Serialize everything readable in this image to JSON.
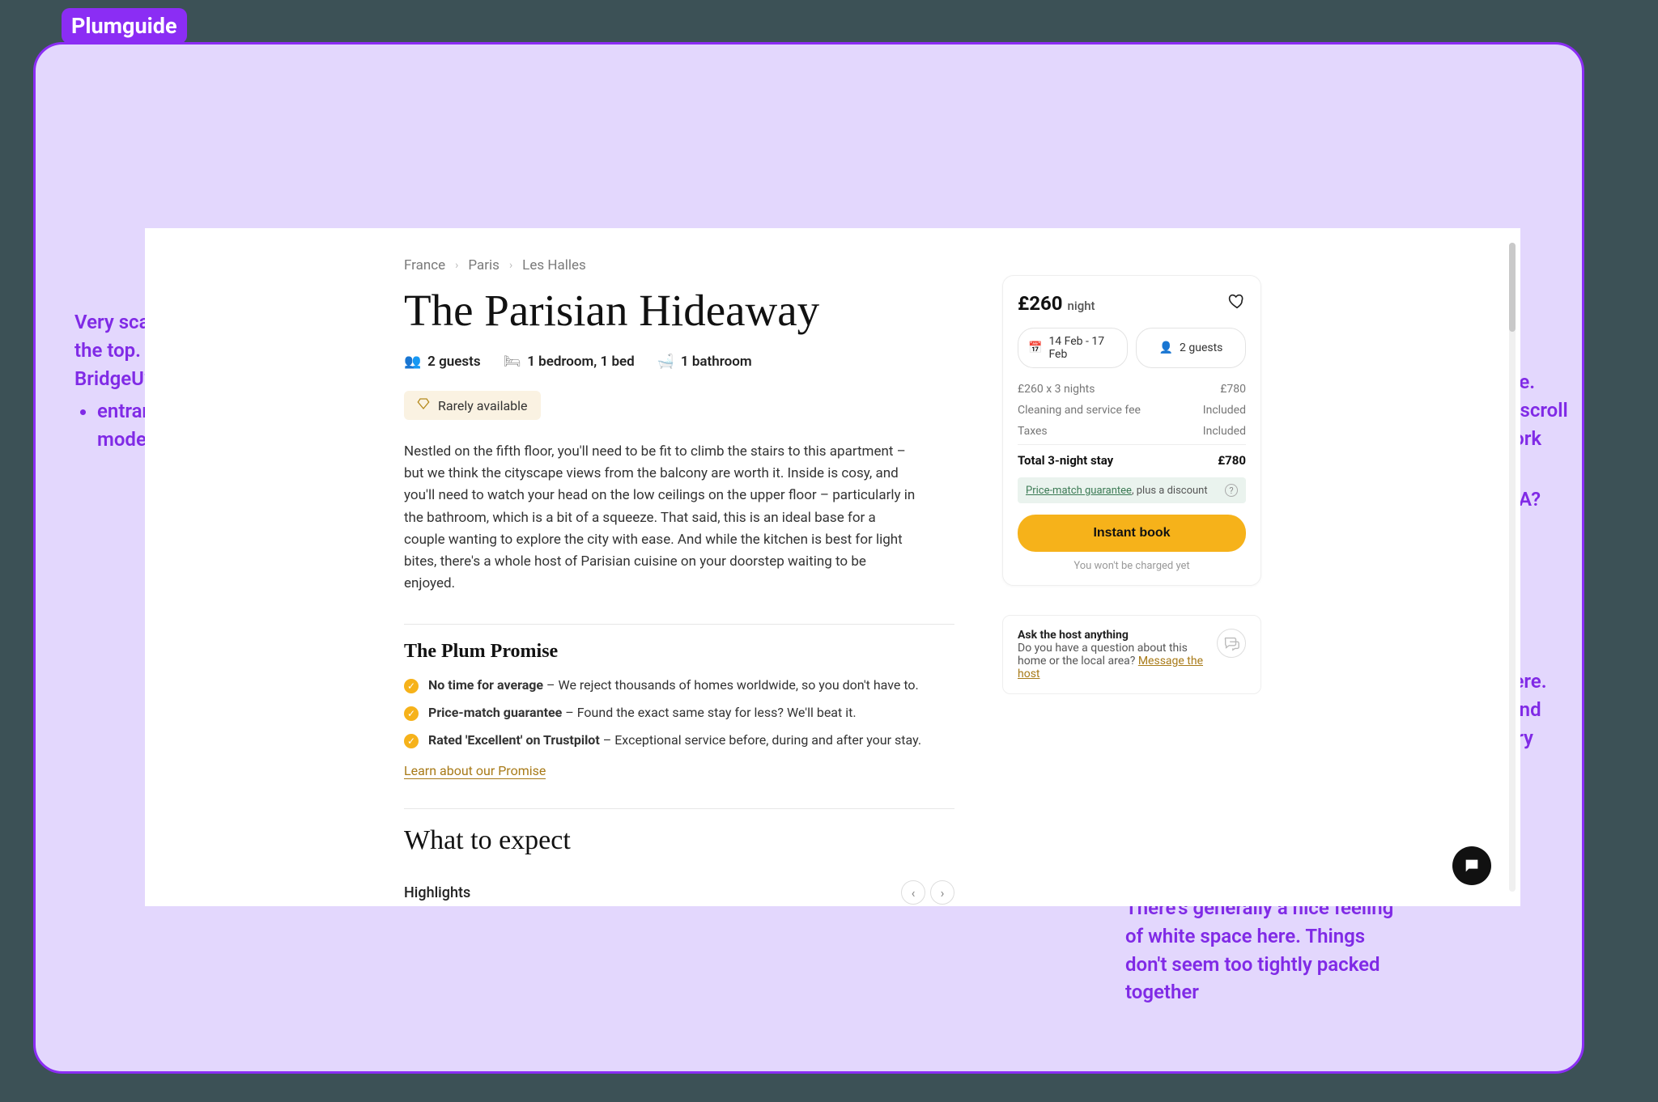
{
  "tag": "Plumguide",
  "breadcrumbs": [
    "France",
    "Paris",
    "Les Halles"
  ],
  "title": "The Parisian Hideaway",
  "keyinfo": {
    "guests": "2 guests",
    "bedrooms": "1 bedroom, 1 bed",
    "bathrooms": "1 bathroom"
  },
  "chip": "Rarely available",
  "description": "Nestled on the fifth floor, you'll need to be fit to climb the stairs to this apartment – but we think the cityscape views from the balcony are worth it. Inside is cosy, and you'll need to watch your head on the low ceilings on the upper floor – particularly in the bathroom, which is a bit of a squeeze. That said, this is an ideal base for a couple wanting to explore the city with ease. And while the kitchen is best for light bites, there's a whole host of Parisian cuisine on your doorstep waiting to be enjoyed.",
  "promise_heading": "The Plum Promise",
  "promises": [
    {
      "bold": "No time for average",
      "rest": " – We reject thousands of homes worldwide, so you don't have to."
    },
    {
      "bold": "Price-match guarantee",
      "rest": " – Found the exact same stay for less? We'll beat it."
    },
    {
      "bold": "Rated 'Excellent' on Trustpilot",
      "rest": " – Exceptional service before, during and after your stay."
    }
  ],
  "learn_link": "Learn about our Promise",
  "expect_heading": "What to expect",
  "highlights_label": "Highlights",
  "booking": {
    "price": "£260",
    "per": "night",
    "dates": "14 Feb - 17 Feb",
    "guests": "2 guests",
    "lines": [
      {
        "k": "£260 x 3 nights",
        "v": "£780"
      },
      {
        "k": "Cleaning and service fee",
        "v": "Included"
      },
      {
        "k": "Taxes",
        "v": "Included"
      }
    ],
    "total_k": "Total 3-night stay",
    "total_v": "£780",
    "pmg_link": "Price-match guarantee",
    "pmg_rest": ", plus a discount",
    "cta": "Instant book",
    "disclaimer": "You won't be charged yet"
  },
  "ask": {
    "title": "Ask the host anything",
    "body": "Do you have a question about this home or the local area? ",
    "link": "Message the host"
  },
  "notes": {
    "top_left": "Very scannable having key info at the top. Would this work for BridgeU?",
    "top_left_bullets": [
      "entrance req, duration, study mode, qualification?"
    ],
    "top_right": "Very interesting card here. Follows the user as they scroll down. How might this work within BridgeU? 🤔",
    "top_right_bullets": [
      "app deadline, fees, CTA?"
    ],
    "mid_right": "Love the use of colour here. Just the CTA, link, chip and icons. No more. Used very appropriately",
    "bottom_right": "There's generally a nice feeling of white space here. Things don't seem too tightly packed together"
  }
}
